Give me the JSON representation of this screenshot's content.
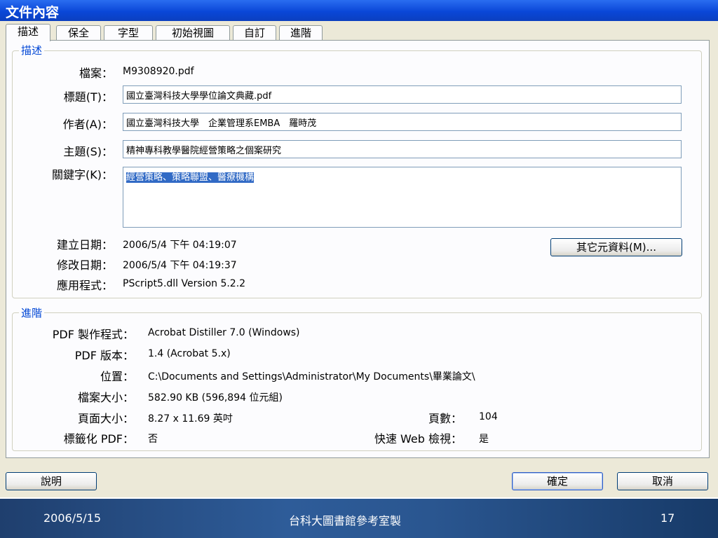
{
  "window": {
    "title": "文件內容"
  },
  "tabs": [
    {
      "label": "描述",
      "active": true
    },
    {
      "label": "保全",
      "active": false
    },
    {
      "label": "字型",
      "active": false
    },
    {
      "label": "初始視圖",
      "active": false
    },
    {
      "label": "自訂",
      "active": false
    },
    {
      "label": "進階",
      "active": false
    }
  ],
  "description": {
    "group_title": "描述",
    "file_label": "檔案：",
    "file_value": "M9308920.pdf",
    "title_label": "標題(T)：",
    "title_value": "國立臺灣科技大學學位論文典藏.pdf",
    "author_label": "作者(A)：",
    "author_value": "國立臺灣科技大學　企業管理系EMBA　羅時茂",
    "subject_label": "主題(S)：",
    "subject_value": "精神專科教學醫院經營策略之個案研究",
    "keywords_label": "關鍵字(K)：",
    "keywords_value": "經營策略、策略聯盟、醫療機構",
    "created_label": "建立日期：",
    "created_value": "2006/5/4 下午 04:19:07",
    "modified_label": "修改日期：",
    "modified_value": "2006/5/4 下午 04:19:37",
    "app_label": "應用程式：",
    "app_value": "PScript5.dll Version 5.2.2",
    "metadata_button": "其它元資料(M)..."
  },
  "advanced": {
    "group_title": "進階",
    "producer_label": "PDF 製作程式：",
    "producer_value": "Acrobat Distiller 7.0 (Windows)",
    "version_label": "PDF 版本：",
    "version_value": "1.4 (Acrobat 5.x)",
    "location_label": "位置：",
    "location_value": "C:\\Documents and Settings\\Administrator\\My Documents\\畢業論文\\",
    "filesize_label": "檔案大小：",
    "filesize_value": "582.90 KB (596,894 位元組)",
    "pagesize_label": "頁面大小：",
    "pagesize_value": "8.27 x 11.69 英吋",
    "pages_label": "頁數：",
    "pages_value": "104",
    "tagged_label": "標籤化 PDF：",
    "tagged_value": "否",
    "fastweb_label": "快速 Web 檢視：",
    "fastweb_value": "是"
  },
  "buttons": {
    "help": "說明",
    "ok": "確定",
    "cancel": "取消"
  },
  "footer": {
    "date": "2006/5/15",
    "center": "台科大圖書館參考室製",
    "page": "17"
  },
  "colors": {
    "title_bar": "#0a47d8",
    "dialog_bg": "#ece9d8",
    "group_title": "#0046d5",
    "selection": "#316ac5",
    "footer_band": "#2e5c99"
  }
}
